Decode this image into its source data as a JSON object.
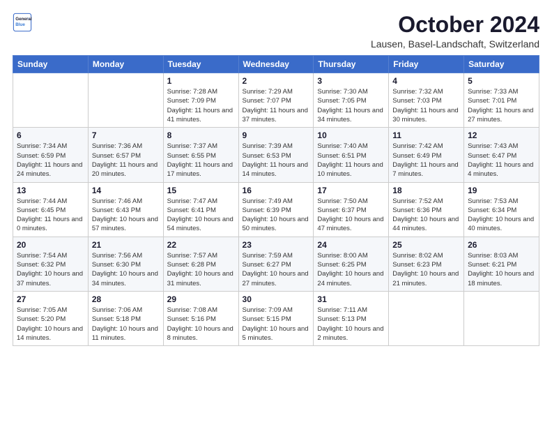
{
  "logo": {
    "line1": "General",
    "line2": "Blue"
  },
  "title": "October 2024",
  "location": "Lausen, Basel-Landschaft, Switzerland",
  "weekdays": [
    "Sunday",
    "Monday",
    "Tuesday",
    "Wednesday",
    "Thursday",
    "Friday",
    "Saturday"
  ],
  "weeks": [
    [
      {
        "day": "",
        "info": ""
      },
      {
        "day": "",
        "info": ""
      },
      {
        "day": "1",
        "info": "Sunrise: 7:28 AM\nSunset: 7:09 PM\nDaylight: 11 hours and 41 minutes."
      },
      {
        "day": "2",
        "info": "Sunrise: 7:29 AM\nSunset: 7:07 PM\nDaylight: 11 hours and 37 minutes."
      },
      {
        "day": "3",
        "info": "Sunrise: 7:30 AM\nSunset: 7:05 PM\nDaylight: 11 hours and 34 minutes."
      },
      {
        "day": "4",
        "info": "Sunrise: 7:32 AM\nSunset: 7:03 PM\nDaylight: 11 hours and 30 minutes."
      },
      {
        "day": "5",
        "info": "Sunrise: 7:33 AM\nSunset: 7:01 PM\nDaylight: 11 hours and 27 minutes."
      }
    ],
    [
      {
        "day": "6",
        "info": "Sunrise: 7:34 AM\nSunset: 6:59 PM\nDaylight: 11 hours and 24 minutes."
      },
      {
        "day": "7",
        "info": "Sunrise: 7:36 AM\nSunset: 6:57 PM\nDaylight: 11 hours and 20 minutes."
      },
      {
        "day": "8",
        "info": "Sunrise: 7:37 AM\nSunset: 6:55 PM\nDaylight: 11 hours and 17 minutes."
      },
      {
        "day": "9",
        "info": "Sunrise: 7:39 AM\nSunset: 6:53 PM\nDaylight: 11 hours and 14 minutes."
      },
      {
        "day": "10",
        "info": "Sunrise: 7:40 AM\nSunset: 6:51 PM\nDaylight: 11 hours and 10 minutes."
      },
      {
        "day": "11",
        "info": "Sunrise: 7:42 AM\nSunset: 6:49 PM\nDaylight: 11 hours and 7 minutes."
      },
      {
        "day": "12",
        "info": "Sunrise: 7:43 AM\nSunset: 6:47 PM\nDaylight: 11 hours and 4 minutes."
      }
    ],
    [
      {
        "day": "13",
        "info": "Sunrise: 7:44 AM\nSunset: 6:45 PM\nDaylight: 11 hours and 0 minutes."
      },
      {
        "day": "14",
        "info": "Sunrise: 7:46 AM\nSunset: 6:43 PM\nDaylight: 10 hours and 57 minutes."
      },
      {
        "day": "15",
        "info": "Sunrise: 7:47 AM\nSunset: 6:41 PM\nDaylight: 10 hours and 54 minutes."
      },
      {
        "day": "16",
        "info": "Sunrise: 7:49 AM\nSunset: 6:39 PM\nDaylight: 10 hours and 50 minutes."
      },
      {
        "day": "17",
        "info": "Sunrise: 7:50 AM\nSunset: 6:37 PM\nDaylight: 10 hours and 47 minutes."
      },
      {
        "day": "18",
        "info": "Sunrise: 7:52 AM\nSunset: 6:36 PM\nDaylight: 10 hours and 44 minutes."
      },
      {
        "day": "19",
        "info": "Sunrise: 7:53 AM\nSunset: 6:34 PM\nDaylight: 10 hours and 40 minutes."
      }
    ],
    [
      {
        "day": "20",
        "info": "Sunrise: 7:54 AM\nSunset: 6:32 PM\nDaylight: 10 hours and 37 minutes."
      },
      {
        "day": "21",
        "info": "Sunrise: 7:56 AM\nSunset: 6:30 PM\nDaylight: 10 hours and 34 minutes."
      },
      {
        "day": "22",
        "info": "Sunrise: 7:57 AM\nSunset: 6:28 PM\nDaylight: 10 hours and 31 minutes."
      },
      {
        "day": "23",
        "info": "Sunrise: 7:59 AM\nSunset: 6:27 PM\nDaylight: 10 hours and 27 minutes."
      },
      {
        "day": "24",
        "info": "Sunrise: 8:00 AM\nSunset: 6:25 PM\nDaylight: 10 hours and 24 minutes."
      },
      {
        "day": "25",
        "info": "Sunrise: 8:02 AM\nSunset: 6:23 PM\nDaylight: 10 hours and 21 minutes."
      },
      {
        "day": "26",
        "info": "Sunrise: 8:03 AM\nSunset: 6:21 PM\nDaylight: 10 hours and 18 minutes."
      }
    ],
    [
      {
        "day": "27",
        "info": "Sunrise: 7:05 AM\nSunset: 5:20 PM\nDaylight: 10 hours and 14 minutes."
      },
      {
        "day": "28",
        "info": "Sunrise: 7:06 AM\nSunset: 5:18 PM\nDaylight: 10 hours and 11 minutes."
      },
      {
        "day": "29",
        "info": "Sunrise: 7:08 AM\nSunset: 5:16 PM\nDaylight: 10 hours and 8 minutes."
      },
      {
        "day": "30",
        "info": "Sunrise: 7:09 AM\nSunset: 5:15 PM\nDaylight: 10 hours and 5 minutes."
      },
      {
        "day": "31",
        "info": "Sunrise: 7:11 AM\nSunset: 5:13 PM\nDaylight: 10 hours and 2 minutes."
      },
      {
        "day": "",
        "info": ""
      },
      {
        "day": "",
        "info": ""
      }
    ]
  ]
}
